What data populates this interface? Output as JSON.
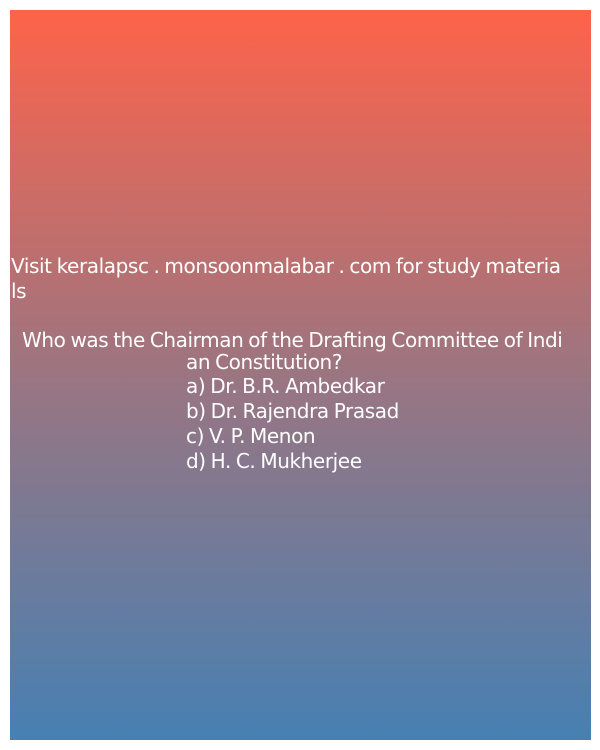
{
  "promo": {
    "line1": "Visit keralapsc . monsoonmalabar . com for study materia",
    "line2": "ls"
  },
  "question": {
    "line1": "Who was the Chairman of the Drafting Committee of Indi",
    "line2": "an Constitution?"
  },
  "options": [
    "a) Dr. B.R. Ambedkar",
    "b) Dr. Rajendra Prasad",
    "c) V. P. Menon",
    "d) H. C. Mukherjee"
  ],
  "colors": {
    "gradient_top": "#fe634a",
    "gradient_middle": "#9b7581",
    "gradient_bottom": "#4680b3",
    "text": "#ffffff"
  }
}
